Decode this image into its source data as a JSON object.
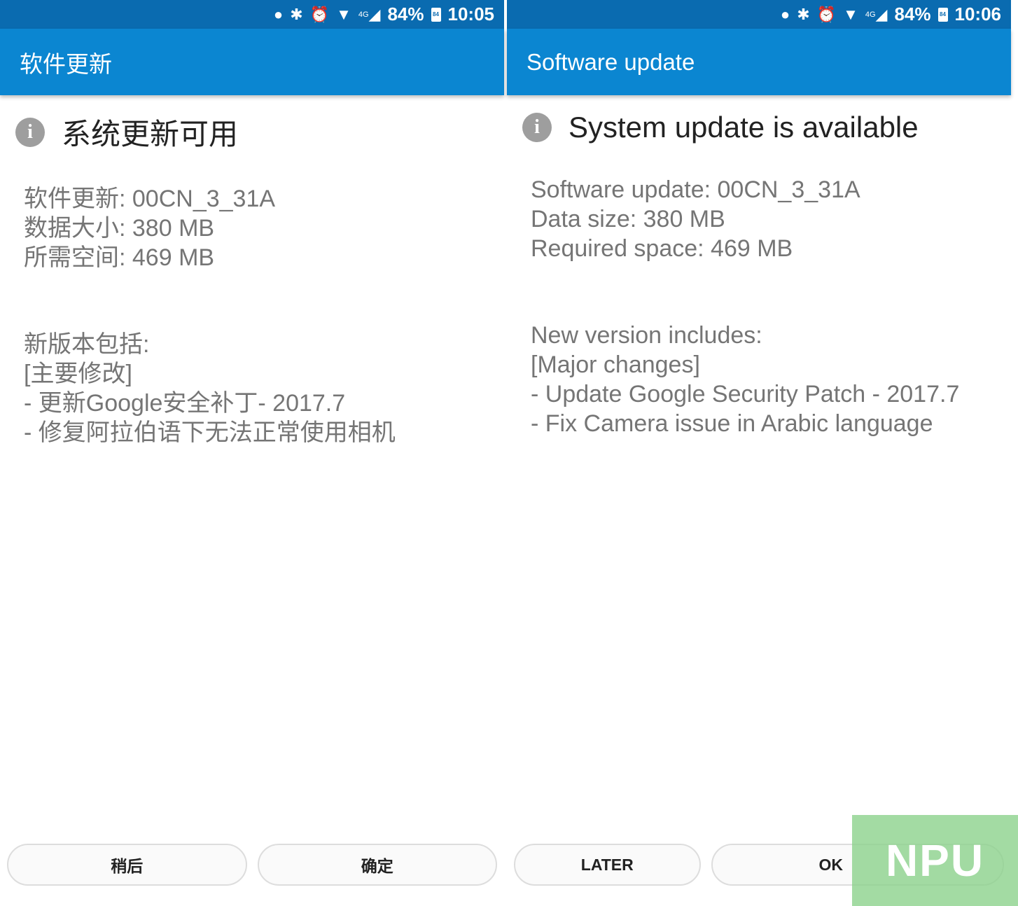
{
  "screens": [
    {
      "status": {
        "battery": "84%",
        "battery_icon_level": "84",
        "time": "10:05",
        "network": "4G"
      },
      "appbar_title": "软件更新",
      "heading": "系统更新可用",
      "details": [
        "软件更新: 00CN_3_31A",
        "数据大小: 380 MB",
        "所需空间: 469 MB"
      ],
      "notes": [
        "新版本包括:",
        "[主要修改]",
        "- 更新Google安全补丁- 2017.7",
        "- 修复阿拉伯语下无法正常使用相机"
      ],
      "buttons": {
        "later": "稍后",
        "ok": "确定"
      }
    },
    {
      "status": {
        "battery": "84%",
        "battery_icon_level": "84",
        "time": "10:06",
        "network": "4G"
      },
      "appbar_title": "Software update",
      "heading": "System update is available",
      "details": [
        "Software update: 00CN_3_31A",
        "Data size: 380 MB",
        "Required space: 469 MB"
      ],
      "notes": [
        "New version includes:",
        "[Major changes]",
        "- Update Google Security Patch - 2017.7",
        "- Fix Camera issue in Arabic language"
      ],
      "buttons": {
        "later": "LATER",
        "ok": "OK"
      }
    }
  ],
  "watermark": "NPU",
  "colors": {
    "status_bar": "#0a6bb0",
    "app_bar": "#0b86d1",
    "info_icon": "#9e9e9e",
    "watermark": "#8cd28c"
  }
}
